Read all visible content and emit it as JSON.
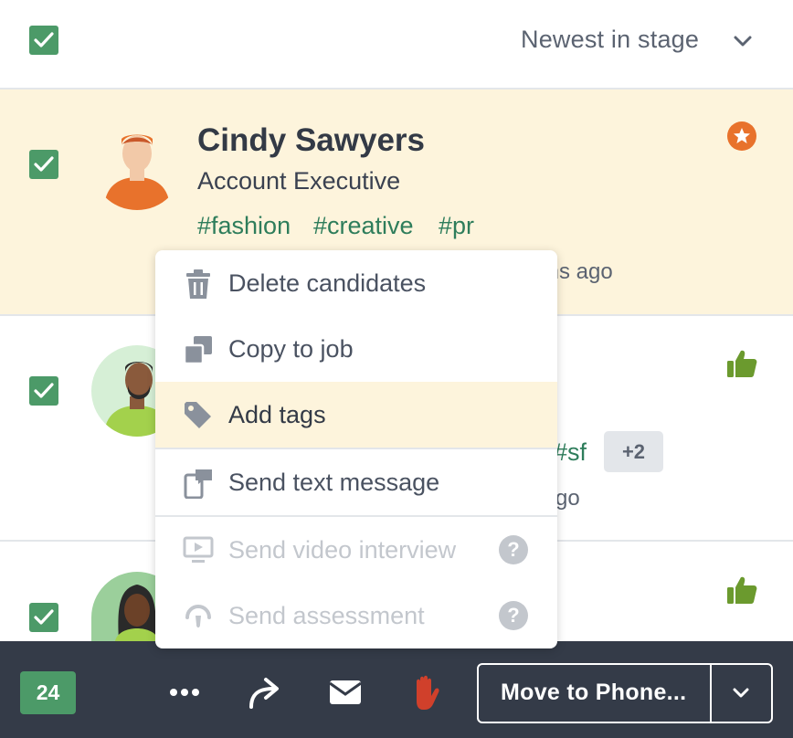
{
  "header": {
    "sort_label": "Newest in stage"
  },
  "candidates": [
    {
      "name": "Cindy Sawyers",
      "title": "Account Executive",
      "tags": [
        "#fashion",
        "#creative",
        "#pr"
      ],
      "time_partial": "ths ago",
      "status": "star"
    },
    {
      "tags_partial": "#sf",
      "more_tags": "+2",
      "time_partial": "go",
      "status": "thumbs-up"
    },
    {
      "status": "thumbs-up"
    }
  ],
  "menu": {
    "items": [
      {
        "label": "Delete candidates",
        "icon": "trash-icon",
        "disabled": false
      },
      {
        "label": "Copy to job",
        "icon": "copy-icon",
        "disabled": false
      },
      {
        "label": "Add tags",
        "icon": "tag-icon",
        "disabled": false,
        "highlighted": true
      },
      {
        "label": "Send text message",
        "icon": "text-message-icon",
        "disabled": false
      },
      {
        "label": "Send video interview",
        "icon": "video-icon",
        "disabled": true,
        "help": "?"
      },
      {
        "label": "Send assessment",
        "icon": "assessment-icon",
        "disabled": true,
        "help": "?"
      }
    ]
  },
  "bottom_bar": {
    "selected_count": "24",
    "move_label": "Move to Phone..."
  },
  "colors": {
    "accent_green": "#4c9a68",
    "tag_green": "#2e7d5b",
    "highlight_row": "#fdf4dc",
    "bottom_bar": "#343b48",
    "reject_red": "#d0402b",
    "star_orange": "#e8722c",
    "thumb_green": "#6b9a2e"
  }
}
